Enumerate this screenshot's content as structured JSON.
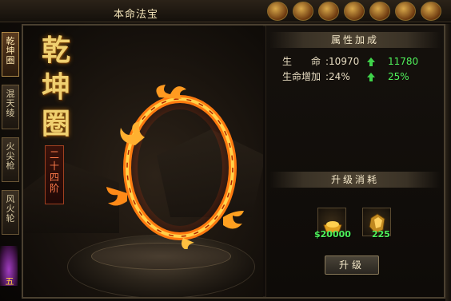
{
  "window": {
    "title": "本命法宝"
  },
  "side_tabs": [
    {
      "label": "乾坤圈",
      "active": true
    },
    {
      "label": "混天绫",
      "active": false
    },
    {
      "label": "火尖枪",
      "active": false
    },
    {
      "label": "风火轮",
      "active": false
    }
  ],
  "side_bottom_text": "五",
  "artifact": {
    "name": "乾坤圈",
    "stage": "二十四阶"
  },
  "attributes": {
    "title": "属性加成",
    "rows": [
      {
        "label": "生　　命",
        "value": ":10970",
        "next": "11780"
      },
      {
        "label": "生命增加",
        "value": ":24%",
        "next": "25%"
      }
    ]
  },
  "upgrade": {
    "title": "升级消耗",
    "costs": [
      {
        "icon": "gold-ingot-icon",
        "amount": "$20000"
      },
      {
        "icon": "gold-ore-icon",
        "amount": "225"
      }
    ],
    "button_label": "升级"
  },
  "colors": {
    "accent_green": "#4ff05a",
    "title_gold": "#f0d070",
    "stage_red": "#ff7b4a"
  }
}
